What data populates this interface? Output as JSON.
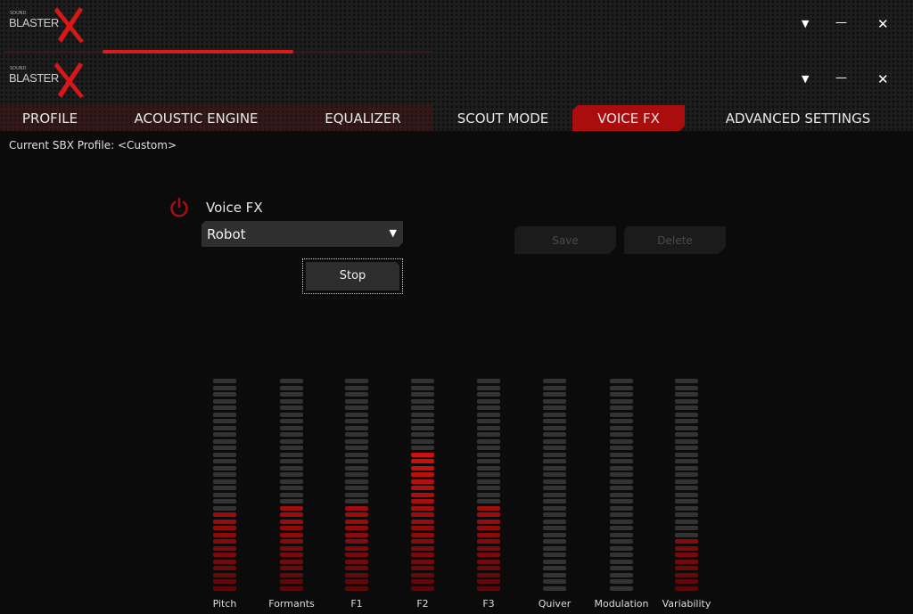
{
  "app": {
    "logo_text": "SOUND BLASTER X",
    "logo_small": "SOUND",
    "logo_main": "BLASTER"
  },
  "window_controls": {
    "menu": "▼",
    "minimize": "—",
    "close": "✕"
  },
  "loading_progress": 0.45,
  "tabs": [
    {
      "label": "PROFILE",
      "active": false
    },
    {
      "label": "ACOUSTIC ENGINE",
      "active": false
    },
    {
      "label": "EQUALIZER",
      "active": false
    },
    {
      "label": "SCOUT MODE",
      "active": false
    },
    {
      "label": "VOICE FX",
      "active": true
    },
    {
      "label": "ADVANCED SETTINGS",
      "active": false
    }
  ],
  "profile_text": "Current SBX Profile: <Custom>",
  "voice_fx": {
    "title": "Voice FX",
    "enabled": true,
    "preset": "Robot",
    "stop_label": "Stop",
    "save_label": "Save",
    "delete_label": "Delete"
  },
  "sliders": {
    "segments_total": 32,
    "items": [
      {
        "label": "Pitch",
        "segments_lit": 12
      },
      {
        "label": "Formants",
        "segments_lit": 13
      },
      {
        "label": "F1",
        "segments_lit": 13
      },
      {
        "label": "F2",
        "segments_lit": 21
      },
      {
        "label": "F3",
        "segments_lit": 13
      },
      {
        "label": "Quiver",
        "segments_lit": 0
      },
      {
        "label": "Modulation",
        "segments_lit": 0
      },
      {
        "label": "Variability",
        "segments_lit": 8
      }
    ]
  },
  "colors": {
    "accent": "#a90d0d",
    "lit_top": "#d41010",
    "lit_bottom": "#5a0808",
    "unlit": "#333333"
  }
}
